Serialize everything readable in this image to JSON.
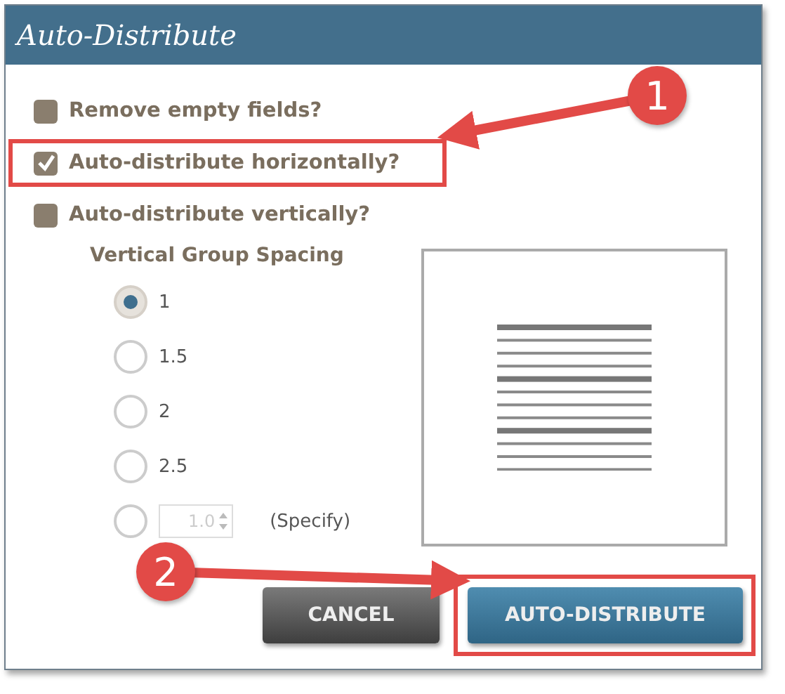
{
  "window": {
    "title": "Auto-Distribute"
  },
  "options": [
    {
      "label": "Remove empty fields?",
      "checked": false,
      "highlighted": false
    },
    {
      "label": "Auto-distribute horizontally?",
      "checked": true,
      "highlighted": true,
      "callout": "1"
    },
    {
      "label": "Auto-distribute vertically?",
      "checked": false,
      "highlighted": false
    }
  ],
  "spacing": {
    "label": "Vertical Group Spacing",
    "choices": [
      {
        "label": "1",
        "selected": true
      },
      {
        "label": "1.5",
        "selected": false
      },
      {
        "label": "2",
        "selected": false
      },
      {
        "label": "2.5",
        "selected": false
      }
    ],
    "custom": {
      "selected": false,
      "value": "1.0",
      "disabled": true,
      "label": "(Specify)"
    }
  },
  "buttons": [
    {
      "label": "CANCEL",
      "kind": "secondary",
      "highlighted": false
    },
    {
      "label": "AUTO-DISTRIBUTE",
      "kind": "primary",
      "highlighted": true,
      "callout": "2"
    }
  ]
}
